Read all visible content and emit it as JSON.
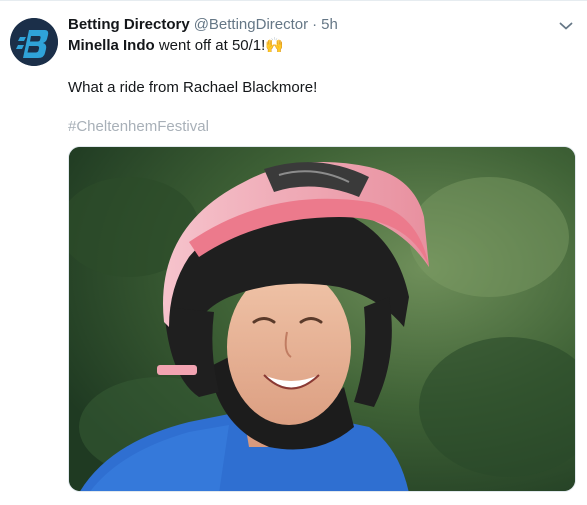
{
  "tweet": {
    "author_name": "Betting Directory",
    "author_handle": "@BettingDirector",
    "separator": "·",
    "timestamp": "5h",
    "text_bold": "Minella Indo",
    "text_line1_rest": " went off at 50/1!",
    "emoji": "🙌",
    "text_line2": "What a ride from Rachael Blackmore!",
    "hashtag": "#CheltenhemFestival"
  },
  "icons": {
    "avatar": "betting-directory-logo",
    "caret": "chevron-down-icon"
  },
  "colors": {
    "avatar_bg": "#1b2f49",
    "logo_blue": "#2fa3d9",
    "text_secondary": "#657786",
    "hashtag_color": "#a8b0b8",
    "helmet_pink": "#f1a7b3",
    "silks_blue": "#2f6fd1"
  }
}
